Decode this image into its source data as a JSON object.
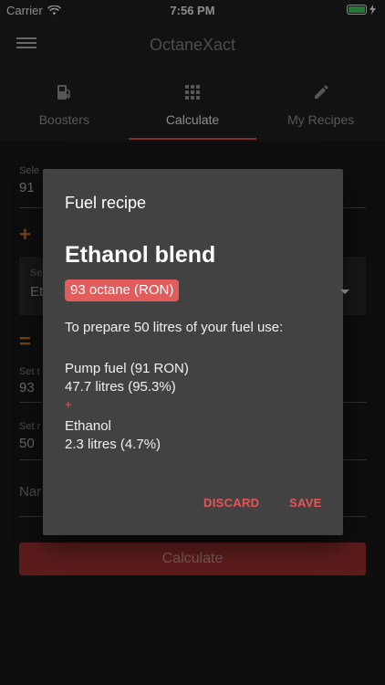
{
  "status_bar": {
    "carrier": "Carrier",
    "time": "7:56 PM"
  },
  "app_bar": {
    "title": "OctaneXact"
  },
  "tabs": [
    {
      "label": "Boosters",
      "icon": "gas-pump-icon"
    },
    {
      "label": "Calculate",
      "icon": "grid-icon",
      "active": true
    },
    {
      "label": "My Recipes",
      "icon": "pencil-icon"
    }
  ],
  "form": {
    "field1_label": "Sele",
    "field1_value": "91",
    "select_label": "Se",
    "select_value": "Et",
    "field2_label": "Set t",
    "field2_value": "93",
    "field3_label": "Set r",
    "field3_value": "50",
    "name_placeholder": "Nar",
    "calculate_label": "Calculate"
  },
  "dialog": {
    "title": "Fuel recipe",
    "recipe_name": "Ethanol blend",
    "octane_badge": "93 octane (RON)",
    "intro": "To prepare 50 litres of your fuel use:",
    "ingredient1_name": "Pump fuel (91 RON)",
    "ingredient1_amount": "47.7 litres (95.3%)",
    "plus": "+",
    "ingredient2_name": "Ethanol",
    "ingredient2_amount": "2.3 litres (4.7%)",
    "discard_label": "DISCARD",
    "save_label": "SAVE"
  },
  "colors": {
    "accent": "#e55555",
    "badge": "#e25c5c",
    "operator": "#d07a2a"
  }
}
